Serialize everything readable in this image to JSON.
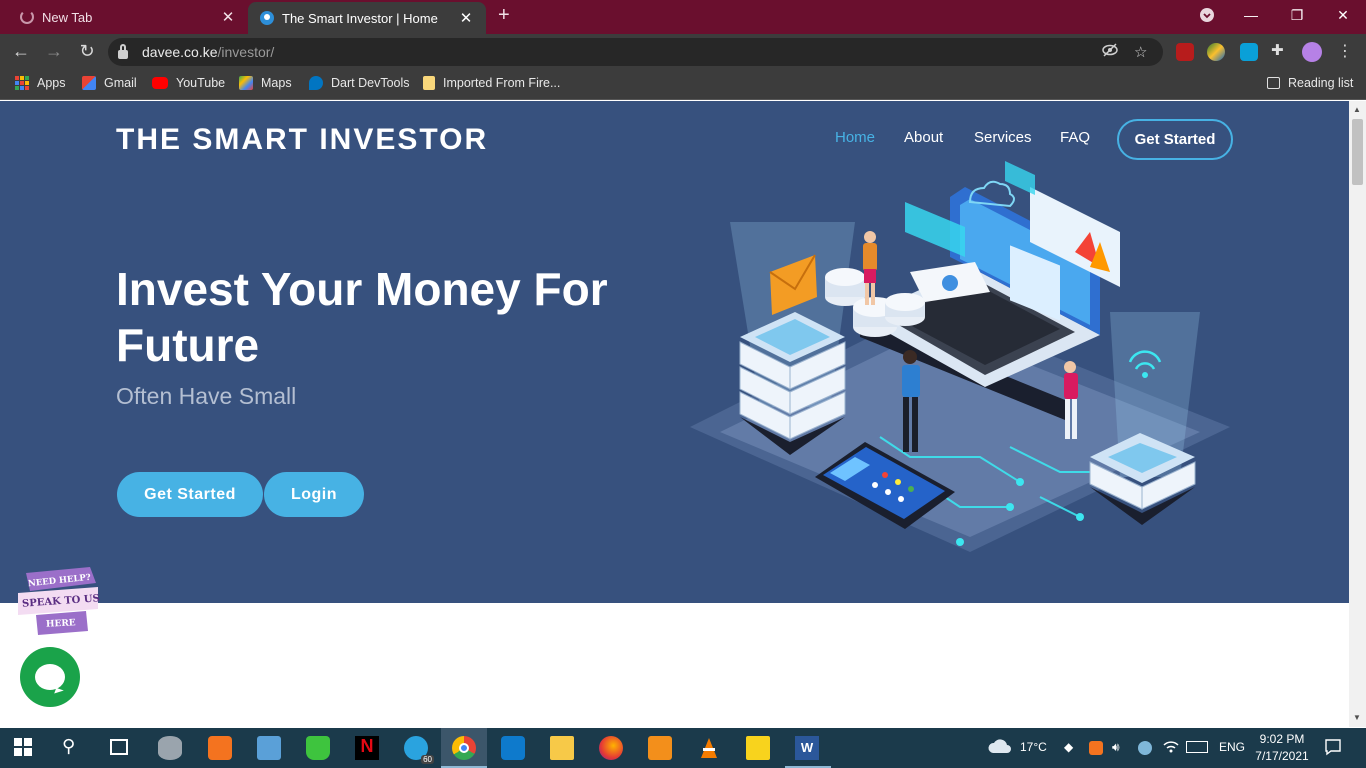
{
  "browser": {
    "tabs": [
      {
        "title": "New Tab",
        "active": false
      },
      {
        "title": "The Smart Investor | Home",
        "active": true
      }
    ],
    "url_host": "davee.co.ke",
    "url_path": "/investor/",
    "bookmarks": [
      {
        "label": "Apps"
      },
      {
        "label": "Gmail"
      },
      {
        "label": "YouTube"
      },
      {
        "label": "Maps"
      },
      {
        "label": "Dart DevTools"
      },
      {
        "label": "Imported From Fire..."
      }
    ],
    "reading_list": "Reading list"
  },
  "site": {
    "brand": "THE SMART INVESTOR",
    "nav": [
      {
        "label": "Home",
        "active": true
      },
      {
        "label": "About",
        "active": false
      },
      {
        "label": "Services",
        "active": false
      },
      {
        "label": "FAQ",
        "active": false
      }
    ],
    "nav_cta": "Get Started",
    "hero": {
      "headline": "Invest Your Money For Future",
      "subline": "Often Have Small",
      "primary_button": "Get Started",
      "secondary_button": "Login"
    },
    "help_badge": {
      "line1": "NEED HELP?",
      "line2": "SPEAK TO US",
      "line3": "HERE"
    },
    "colors": {
      "hero_bg": "#37517e",
      "accent": "#47b2e4",
      "chat": "#1aa34a"
    }
  },
  "taskbar": {
    "weather": "17°C",
    "language": "ENG",
    "time": "9:02 PM",
    "date": "7/17/2021",
    "telegram_badge": "60"
  }
}
